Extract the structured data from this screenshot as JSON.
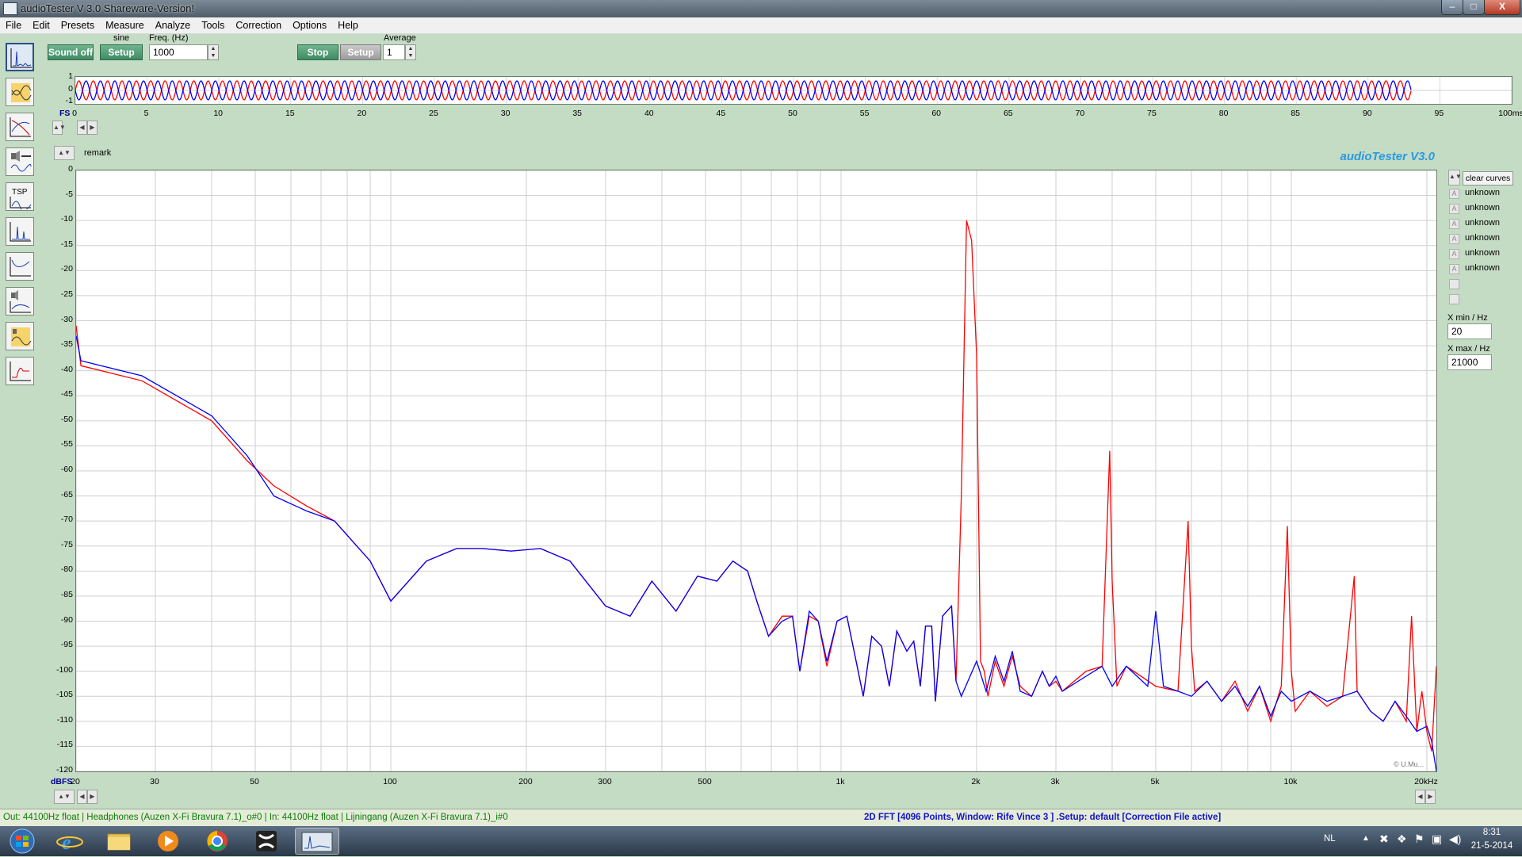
{
  "window": {
    "title": "audioTester  V 3.0 Shareware-Version!",
    "minimize": "–",
    "restore": "□",
    "close": "X"
  },
  "menu": [
    "File",
    "Edit",
    "Presets",
    "Measure",
    "Analyze",
    "Tools",
    "Correction",
    "Options",
    "Help"
  ],
  "generator": {
    "sound_button": "Sound off",
    "waveform_label": "sine",
    "setup_button": "Setup",
    "freq_label": "Freq. (Hz)",
    "freq_value": "1000"
  },
  "analyzer": {
    "stop_button": "Stop",
    "setup_button": "Setup",
    "average_label": "Average",
    "average_value": "1"
  },
  "time_plot": {
    "y_ticks": [
      "1",
      "0",
      "-1"
    ],
    "x_unit_left": "FS",
    "x_ticks": [
      "0",
      "5",
      "10",
      "15",
      "20",
      "25",
      "30",
      "35",
      "40",
      "45",
      "50",
      "55",
      "60",
      "65",
      "70",
      "75",
      "80",
      "85",
      "90",
      "95",
      "100ms"
    ],
    "cycles": 93,
    "xlim": [
      0,
      100
    ]
  },
  "remark_label": "remark",
  "brand": "audioTester  V3.0",
  "copyright": "© U.Mu...",
  "chart_data": {
    "type": "line",
    "title": "",
    "xlabel": "",
    "ylabel": "dBFS",
    "x_scale": "log",
    "xlim": [
      20,
      21000
    ],
    "ylim": [
      -120,
      0
    ],
    "y_ticks": [
      "0",
      "-5",
      "-10",
      "-15",
      "-20",
      "-25",
      "-30",
      "-35",
      "-40",
      "-45",
      "-50",
      "-55",
      "-60",
      "-65",
      "-70",
      "-75",
      "-80",
      "-85",
      "-90",
      "-95",
      "-100",
      "-105",
      "-110",
      "-115",
      "-120"
    ],
    "x_ticks": [
      {
        "v": 20,
        "label": "20"
      },
      {
        "v": 30,
        "label": "30"
      },
      {
        "v": 50,
        "label": "50"
      },
      {
        "v": 100,
        "label": "100"
      },
      {
        "v": 200,
        "label": "200"
      },
      {
        "v": 300,
        "label": "300"
      },
      {
        "v": 500,
        "label": "500"
      },
      {
        "v": 1000,
        "label": "1k"
      },
      {
        "v": 2000,
        "label": "2k"
      },
      {
        "v": 3000,
        "label": "3k"
      },
      {
        "v": 5000,
        "label": "5k"
      },
      {
        "v": 10000,
        "label": "10k"
      },
      {
        "v": 20000,
        "label": "20kHz"
      }
    ],
    "grid": true,
    "series": [
      {
        "color": "#ff0000",
        "points": [
          [
            20,
            -31
          ],
          [
            20.5,
            -39
          ],
          [
            28,
            -42
          ],
          [
            40,
            -50
          ],
          [
            48,
            -58
          ],
          [
            55,
            -63
          ],
          [
            65,
            -67
          ],
          [
            75,
            -70
          ],
          [
            90,
            -78
          ],
          [
            100,
            -86
          ],
          [
            120,
            -78
          ],
          [
            140,
            -75.5
          ],
          [
            160,
            -75.5
          ],
          [
            185,
            -76
          ],
          [
            215,
            -75.5
          ],
          [
            250,
            -78
          ],
          [
            300,
            -87
          ],
          [
            340,
            -89
          ],
          [
            380,
            -82
          ],
          [
            430,
            -88
          ],
          [
            480,
            -81
          ],
          [
            530,
            -82
          ],
          [
            575,
            -78
          ],
          [
            620,
            -80
          ],
          [
            650,
            -86
          ],
          [
            690,
            -93
          ],
          [
            740,
            -89
          ],
          [
            780,
            -89
          ],
          [
            810,
            -100
          ],
          [
            850,
            -89
          ],
          [
            890,
            -90
          ],
          [
            930,
            -99
          ],
          [
            980,
            -90
          ],
          [
            1030,
            -89
          ],
          [
            1080,
            -98
          ],
          [
            1120,
            -105
          ],
          [
            1170,
            -93
          ],
          [
            1230,
            -95
          ],
          [
            1280,
            -103
          ],
          [
            1330,
            -92
          ],
          [
            1400,
            -96
          ],
          [
            1450,
            -94
          ],
          [
            1500,
            -103
          ],
          [
            1540,
            -91
          ],
          [
            1590,
            -91
          ],
          [
            1620,
            -106
          ],
          [
            1680,
            -89
          ],
          [
            1760,
            -87
          ],
          [
            1800,
            -102
          ],
          [
            1850,
            -65
          ],
          [
            1900,
            -10
          ],
          [
            1950,
            -14
          ],
          [
            2000,
            -37
          ],
          [
            2040,
            -98
          ],
          [
            2080,
            -100
          ],
          [
            2120,
            -105
          ],
          [
            2200,
            -98
          ],
          [
            2300,
            -103
          ],
          [
            2400,
            -97
          ],
          [
            2500,
            -103
          ],
          [
            2650,
            -105
          ],
          [
            2800,
            -100
          ],
          [
            2900,
            -103
          ],
          [
            3000,
            -102
          ],
          [
            3100,
            -104
          ],
          [
            3500,
            -100
          ],
          [
            3800,
            -99
          ],
          [
            3950,
            -56
          ],
          [
            4000,
            -82
          ],
          [
            4100,
            -103
          ],
          [
            4300,
            -99
          ],
          [
            5000,
            -103
          ],
          [
            5600,
            -104
          ],
          [
            5900,
            -70
          ],
          [
            6000,
            -95
          ],
          [
            6100,
            -104
          ],
          [
            6500,
            -102
          ],
          [
            7000,
            -106
          ],
          [
            7500,
            -102
          ],
          [
            8000,
            -108
          ],
          [
            8500,
            -103
          ],
          [
            9000,
            -110
          ],
          [
            9500,
            -103
          ],
          [
            9800,
            -71
          ],
          [
            10000,
            -100
          ],
          [
            10200,
            -108
          ],
          [
            11000,
            -104
          ],
          [
            12000,
            -107
          ],
          [
            13000,
            -105
          ],
          [
            13800,
            -81
          ],
          [
            14000,
            -104
          ],
          [
            15000,
            -108
          ],
          [
            16000,
            -110
          ],
          [
            17000,
            -106
          ],
          [
            18000,
            -110
          ],
          [
            18500,
            -89
          ],
          [
            19000,
            -112
          ],
          [
            19500,
            -104
          ],
          [
            20000,
            -112
          ],
          [
            20500,
            -116
          ],
          [
            21000,
            -99
          ]
        ]
      },
      {
        "color": "#0000ff",
        "points": [
          [
            20,
            -33
          ],
          [
            20.5,
            -38
          ],
          [
            28,
            -41
          ],
          [
            40,
            -49
          ],
          [
            48,
            -57
          ],
          [
            55,
            -65
          ],
          [
            65,
            -68
          ],
          [
            75,
            -70
          ],
          [
            90,
            -78
          ],
          [
            100,
            -86
          ],
          [
            120,
            -78
          ],
          [
            140,
            -75.5
          ],
          [
            160,
            -75.5
          ],
          [
            185,
            -76
          ],
          [
            215,
            -75.5
          ],
          [
            250,
            -78
          ],
          [
            300,
            -87
          ],
          [
            340,
            -89
          ],
          [
            380,
            -82
          ],
          [
            430,
            -88
          ],
          [
            480,
            -81
          ],
          [
            530,
            -82
          ],
          [
            575,
            -78
          ],
          [
            620,
            -80
          ],
          [
            650,
            -86
          ],
          [
            690,
            -93
          ],
          [
            740,
            -90
          ],
          [
            780,
            -89
          ],
          [
            810,
            -100
          ],
          [
            850,
            -88
          ],
          [
            890,
            -90
          ],
          [
            930,
            -98
          ],
          [
            980,
            -90
          ],
          [
            1030,
            -89
          ],
          [
            1080,
            -98
          ],
          [
            1120,
            -105
          ],
          [
            1170,
            -93
          ],
          [
            1230,
            -95
          ],
          [
            1280,
            -103
          ],
          [
            1330,
            -92
          ],
          [
            1400,
            -96
          ],
          [
            1450,
            -94
          ],
          [
            1500,
            -103
          ],
          [
            1540,
            -91
          ],
          [
            1590,
            -91
          ],
          [
            1620,
            -106
          ],
          [
            1680,
            -89
          ],
          [
            1760,
            -87
          ],
          [
            1800,
            -102
          ],
          [
            1850,
            -105
          ],
          [
            2000,
            -98
          ],
          [
            2100,
            -104
          ],
          [
            2200,
            -97
          ],
          [
            2300,
            -102
          ],
          [
            2400,
            -96
          ],
          [
            2500,
            -104
          ],
          [
            2650,
            -105
          ],
          [
            2800,
            -100
          ],
          [
            2900,
            -103
          ],
          [
            3000,
            -101
          ],
          [
            3100,
            -104
          ],
          [
            3500,
            -101
          ],
          [
            3800,
            -99
          ],
          [
            4000,
            -103
          ],
          [
            4300,
            -99
          ],
          [
            4800,
            -103
          ],
          [
            5000,
            -88
          ],
          [
            5200,
            -103
          ],
          [
            5600,
            -104
          ],
          [
            6000,
            -105
          ],
          [
            6500,
            -102
          ],
          [
            7000,
            -106
          ],
          [
            7500,
            -103
          ],
          [
            8000,
            -107
          ],
          [
            8500,
            -103
          ],
          [
            9000,
            -109
          ],
          [
            9500,
            -104
          ],
          [
            10000,
            -106
          ],
          [
            11000,
            -104
          ],
          [
            12000,
            -106
          ],
          [
            13000,
            -105
          ],
          [
            14000,
            -104
          ],
          [
            15000,
            -108
          ],
          [
            16000,
            -110
          ],
          [
            17000,
            -106
          ],
          [
            18000,
            -109
          ],
          [
            19000,
            -112
          ],
          [
            20000,
            -111
          ],
          [
            20500,
            -114
          ],
          [
            21000,
            -120
          ]
        ]
      }
    ]
  },
  "legend": {
    "clear_button": "clear curves",
    "items": [
      "unknown",
      "unknown",
      "unknown",
      "unknown",
      "unknown",
      "unknown",
      "",
      ""
    ],
    "xmin_label": "X min / Hz",
    "xmin_value": "20",
    "xmax_label": "X max / Hz",
    "xmax_value": "21000"
  },
  "status": {
    "left": "Out: 44100Hz float  | Headphones (Auzen X-Fi Bravura 7.1)_o#0  | In: 44100Hz float  | Lijningang (Auzen X-Fi Bravura 7.1)_i#0",
    "right": "2D FFT [4096 Points, Window: Rife Vince 3 ]  .Setup:  default  [Correction File active]"
  },
  "taskbar": {
    "lang": "NL",
    "time": "8:31",
    "date": "21-5-2014"
  }
}
